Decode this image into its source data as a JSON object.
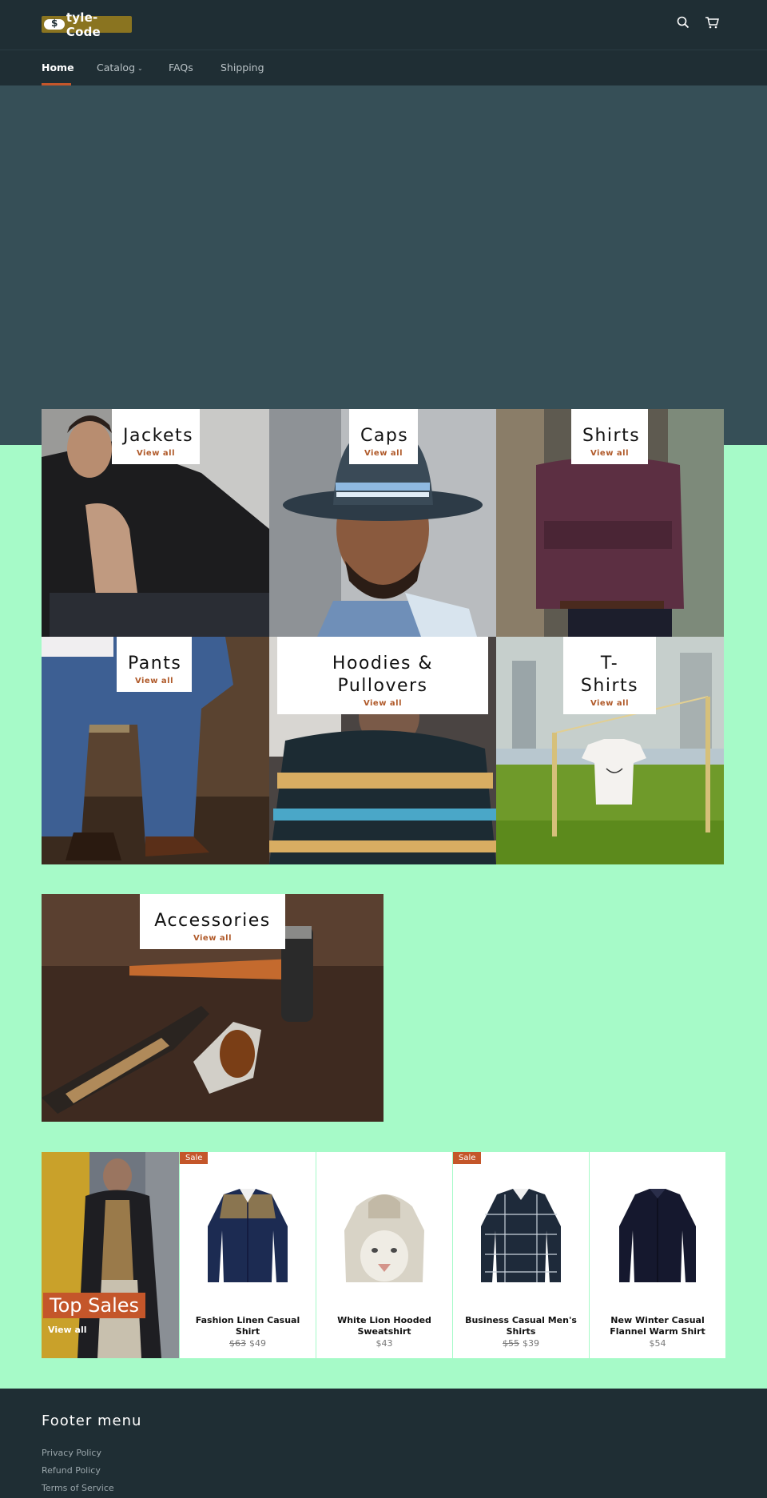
{
  "header": {
    "logo_text": "tyle-Code",
    "search_icon": "search-icon",
    "cart_icon": "cart-icon"
  },
  "nav": {
    "items": [
      {
        "label": "Home",
        "active": true
      },
      {
        "label": "Catalog",
        "has_dropdown": true
      },
      {
        "label": "FAQs"
      },
      {
        "label": "Shipping"
      }
    ]
  },
  "collections": [
    {
      "title": "Jackets",
      "link": "View all"
    },
    {
      "title": "Caps",
      "link": "View all"
    },
    {
      "title": "Shirts",
      "link": "View all"
    },
    {
      "title": "Pants",
      "link": "View all"
    },
    {
      "title": "Hoodies & Pullovers",
      "link": "View all"
    },
    {
      "title": "T-Shirts",
      "link": "View all"
    },
    {
      "title": "Accessories",
      "link": "View all"
    }
  ],
  "top_sales": {
    "title": "Top Sales",
    "link": "View all",
    "products": [
      {
        "name": "Fashion Linen Casual Shirt",
        "sale_badge": "Sale",
        "old_price": "$63",
        "price": "$49"
      },
      {
        "name": "White Lion Hooded Sweatshirt",
        "sale_badge": "",
        "old_price": "",
        "price": "$43"
      },
      {
        "name": "Business Casual Men's Shirts",
        "sale_badge": "Sale",
        "old_price": "$55",
        "price": "$39"
      },
      {
        "name": "New Winter Casual Flannel Warm Shirt",
        "sale_badge": "",
        "old_price": "",
        "price": "$54"
      }
    ]
  },
  "footer": {
    "title": "Footer menu",
    "links": [
      "Privacy Policy",
      "Refund Policy",
      "Terms of Service"
    ]
  },
  "colors": {
    "page_background": "#a6fac8",
    "header_background": "#1f2e34",
    "hero_background": "#364f57",
    "accent": "#c4562a"
  }
}
